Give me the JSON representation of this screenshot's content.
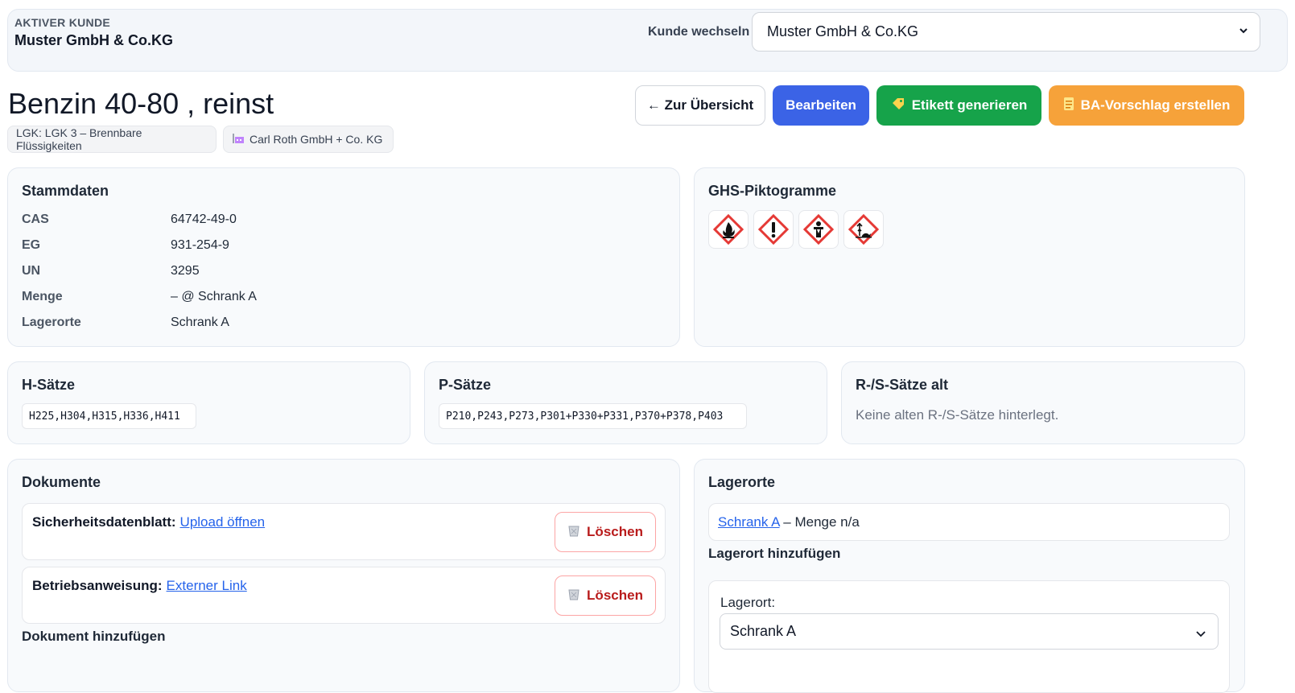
{
  "customer": {
    "caption": "AKTIVER KUNDE",
    "name": "Muster GmbH & Co.KG",
    "switch_label": "Kunde wechseln",
    "selected": "Muster GmbH & Co.KG"
  },
  "product": {
    "title": "Benzin 40-80 , reinst",
    "badges": {
      "lgk": "LGK: LGK 3 – Brennbare Flüssigkeiten",
      "supplier": "Carl Roth GmbH + Co. KG"
    }
  },
  "actions": {
    "overview": "← Zur Übersicht",
    "edit": "Bearbeiten",
    "label": "Etikett generieren",
    "ba": "BA-Vorschlag erstellen"
  },
  "stammdaten": {
    "title": "Stammdaten",
    "rows": [
      {
        "key": "CAS",
        "value": "64742-49-0"
      },
      {
        "key": "EG",
        "value": "931-254-9"
      },
      {
        "key": "UN",
        "value": "3295"
      },
      {
        "key": "Menge",
        "value": "– @ Schrank A"
      },
      {
        "key": "Lagerorte",
        "value": "Schrank A"
      }
    ]
  },
  "ghs": {
    "title": "GHS-Piktogramme",
    "icons": [
      "flame-icon",
      "exclamation-icon",
      "health-hazard-icon",
      "environment-icon"
    ],
    "colors": {
      "border": "#e53935"
    }
  },
  "h_saetze": {
    "title": "H-Sätze",
    "value": "H225,H304,H315,H336,H411"
  },
  "p_saetze": {
    "title": "P-Sätze",
    "value": "P210,P243,P273,P301+P330+P331,P370+P378,P403"
  },
  "rs_saetze": {
    "title": "R-/S-Sätze alt",
    "empty": "Keine alten R-/S-Sätze hinterlegt."
  },
  "dokumente": {
    "title": "Dokumente",
    "items": [
      {
        "label": "Sicherheitsdatenblatt:",
        "link": "Upload öffnen",
        "delete": "Löschen"
      },
      {
        "label": "Betriebsanweisung:",
        "link": "Externer Link",
        "delete": "Löschen"
      }
    ],
    "add_heading": "Dokument hinzufügen"
  },
  "lagerorte": {
    "title": "Lagerorte",
    "entry_link": "Schrank A",
    "entry_rest": " – Menge n/a",
    "add_heading": "Lagerort hinzufügen",
    "field_label": "Lagerort:",
    "field_value": "Schrank A"
  }
}
